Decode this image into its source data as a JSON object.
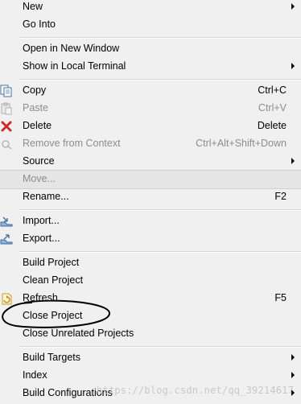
{
  "menu": {
    "new": "New",
    "go_into": "Go Into",
    "open_new_window": "Open in New Window",
    "show_local_terminal": "Show in Local Terminal",
    "copy": "Copy",
    "copy_shortcut": "Ctrl+C",
    "paste": "Paste",
    "paste_shortcut": "Ctrl+V",
    "delete": "Delete",
    "delete_shortcut": "Delete",
    "remove_from_context": "Remove from Context",
    "remove_shortcut": "Ctrl+Alt+Shift+Down",
    "source": "Source",
    "move": "Move...",
    "rename": "Rename...",
    "rename_shortcut": "F2",
    "import": "Import...",
    "export": "Export...",
    "build_project": "Build Project",
    "clean_project": "Clean Project",
    "refresh": "Refresh",
    "refresh_shortcut": "F5",
    "close_project": "Close Project",
    "close_unrelated": "Close Unrelated Projects",
    "build_targets": "Build Targets",
    "index": "Index",
    "build_configurations": "Build Configurations"
  },
  "watermark": "https://blog.csdn.net/qq_39214617",
  "colors": {
    "menu_bg": "#f0f0f0",
    "disabled_text": "#8d8d8d",
    "delete_icon": "#d22a2a",
    "annotation": "#000000"
  }
}
